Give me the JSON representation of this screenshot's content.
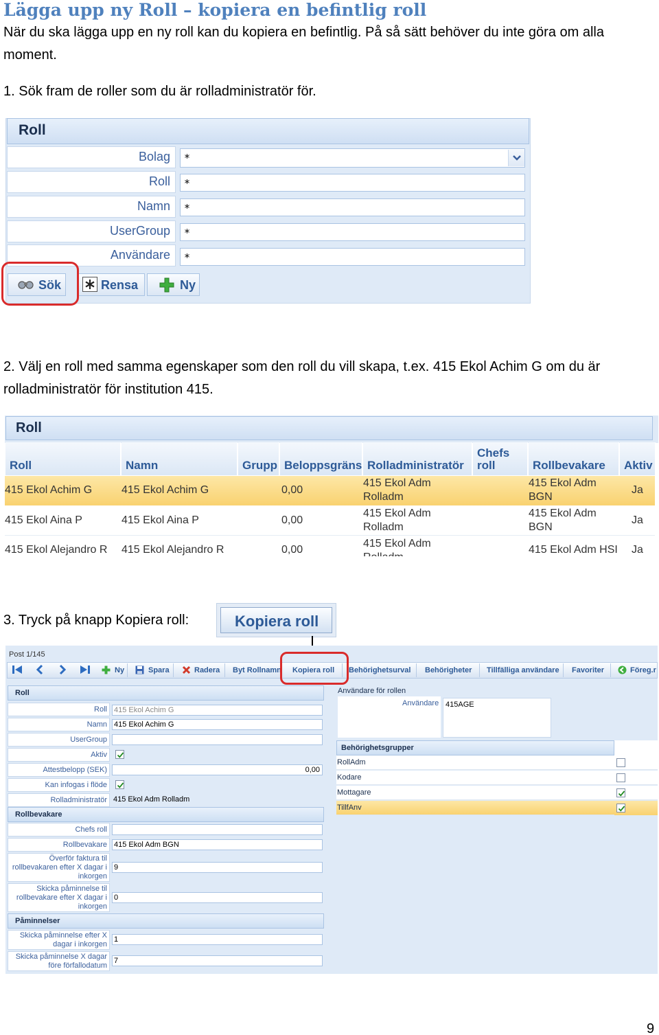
{
  "doc": {
    "title": "Lägga upp ny Roll – kopiera en befintlig roll",
    "intro_line1": "När du ska lägga upp en ny roll kan du kopiera en befintlig. På så sätt behöver du inte göra om alla",
    "intro_line2": "moment.",
    "step1": "1. Sök fram de roller som du är rolladministratör för.",
    "step2_line1": "2. Välj en roll med samma egenskaper som den roll du vill skapa, t.ex. 415 Ekol Achim G om du är",
    "step2_line2": "rolladministratör för institution 415.",
    "step3": "3. Tryck på knapp Kopiera roll:",
    "page_number": "9"
  },
  "search_form": {
    "title": "Roll",
    "fields": [
      {
        "label": "Bolag",
        "value": "*"
      },
      {
        "label": "Roll",
        "value": "*"
      },
      {
        "label": "Namn",
        "value": "*"
      },
      {
        "label": "UserGroup",
        "value": "*"
      },
      {
        "label": "Användare",
        "value": "*"
      }
    ],
    "buttons": {
      "search": "Sök",
      "clear": "Rensa",
      "new": "Ny"
    }
  },
  "results": {
    "title": "Roll",
    "columns": [
      "Roll",
      "Namn",
      "Grupp",
      "Beloppsgräns",
      "Rolladministratör",
      "Chefs roll",
      "Rollbevakare",
      "Aktiv"
    ],
    "rows": [
      {
        "roll": "415 Ekol Achim G",
        "namn": "415 Ekol Achim G",
        "belopp": "0,00",
        "admin1": "415 Ekol Adm",
        "admin2": "Rolladm",
        "bev1": "415 Ekol Adm",
        "bev2": "BGN",
        "aktiv": "Ja"
      },
      {
        "roll": "415 Ekol Aina P",
        "namn": "415 Ekol Aina P",
        "belopp": "0,00",
        "admin1": "415 Ekol Adm",
        "admin2": "Rolladm",
        "bev1": "415 Ekol Adm",
        "bev2": "BGN",
        "aktiv": "Ja"
      },
      {
        "roll": "415 Ekol Alejandro R",
        "namn": "415 Ekol Alejandro R",
        "belopp": "0,00",
        "admin1": "415 Ekol Adm",
        "admin2": "Rolladm",
        "bev1": "415 Ekol Adm HSI",
        "bev2": "",
        "aktiv": "Ja"
      }
    ],
    "selected_color": "#fbd978"
  },
  "copy_button": {
    "label": "Kopiera roll"
  },
  "detail": {
    "post": "Post 1/145",
    "toolbar": {
      "new": "Ny",
      "save": "Spara",
      "delete": "Radera",
      "rename": "Byt Rollnamn",
      "copy": "Kopiera roll",
      "selection": "Behörighetsurval",
      "permissions": "Behörigheter",
      "temp_users": "Tillfälliga användare",
      "favorites": "Favoriter",
      "prev": "Föreg.r"
    },
    "roll_section": "Roll",
    "fields": {
      "roll_label": "Roll",
      "roll_value": "415 Ekol Achim G",
      "namn_label": "Namn",
      "namn_value": "415 Ekol Achim G",
      "usergroup_label": "UserGroup",
      "usergroup_value": "",
      "aktiv_label": "Aktiv",
      "attest_label": "Attestbelopp (SEK)",
      "attest_value": "0,00",
      "infogas_label": "Kan infogas i flöde",
      "admin_label": "Rolladministratör",
      "admin_value": "415 Ekol Adm Rolladm"
    },
    "bevakare_section": "Rollbevakare",
    "bevakare": {
      "chefs_label": "Chefs roll",
      "chefs_value": "",
      "bev_label": "Rollbevakare",
      "bev_value": "415 Ekol Adm BGN",
      "faktura_l1": "Överför faktura til",
      "faktura_l2": "rollbevakaren efter X dagar i",
      "faktura_l3": "inkorgen",
      "faktura_value": "9",
      "pamin_l1": "Skicka påminnelse til",
      "pamin_l2": "rollbevakare efter X dagar i",
      "pamin_l3": "inkorgen",
      "pamin_value": "0"
    },
    "paminnelser_section": "Påminnelser",
    "paminnelser": {
      "p1_l1": "Skicka påminnelse efter X",
      "p1_l2": "dagar i inkorgen",
      "p1_value": "1",
      "p2_l1": "Skicka påminnelse X dagar",
      "p2_l2": "före förfallodatum",
      "p2_value": "7"
    },
    "users_title": "Användare för rollen",
    "users_label": "Användare",
    "users_value": "415AGE",
    "groups_title": "Behörighetsgrupper",
    "groups": [
      {
        "name": "RollAdm",
        "checked": false
      },
      {
        "name": "Kodare",
        "checked": false
      },
      {
        "name": "Mottagare",
        "checked": true
      },
      {
        "name": "TillfAnv",
        "checked": true
      }
    ]
  }
}
